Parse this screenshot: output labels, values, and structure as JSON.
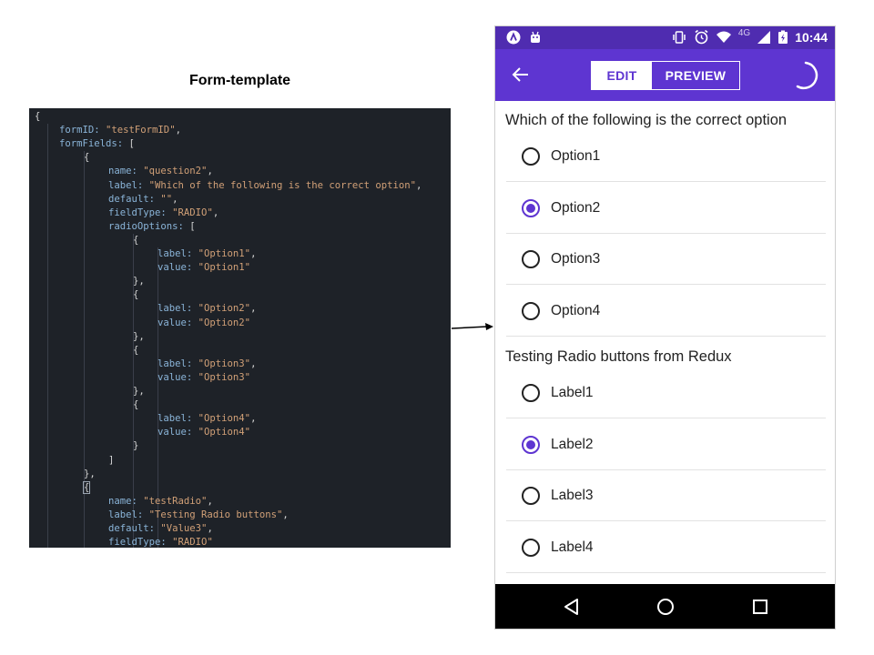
{
  "template": {
    "title": "Form-template",
    "code_lines": [
      {
        "indent": 0,
        "parts": [
          {
            "t": "{",
            "c": "p"
          }
        ]
      },
      {
        "indent": 1,
        "parts": [
          {
            "t": "formID: ",
            "c": "k"
          },
          {
            "t": "\"testFormID\"",
            "c": "s"
          },
          {
            "t": ",",
            "c": "p"
          }
        ]
      },
      {
        "indent": 1,
        "parts": [
          {
            "t": "formFields: ",
            "c": "k"
          },
          {
            "t": "[",
            "c": "p"
          }
        ]
      },
      {
        "indent": 2,
        "parts": [
          {
            "t": "{",
            "c": "p"
          }
        ]
      },
      {
        "indent": 3,
        "parts": [
          {
            "t": "name: ",
            "c": "k"
          },
          {
            "t": "\"question2\"",
            "c": "s"
          },
          {
            "t": ",",
            "c": "p"
          }
        ]
      },
      {
        "indent": 3,
        "parts": [
          {
            "t": "label: ",
            "c": "k"
          },
          {
            "t": "\"Which of the following is the correct option\"",
            "c": "s"
          },
          {
            "t": ",",
            "c": "p"
          }
        ]
      },
      {
        "indent": 3,
        "parts": [
          {
            "t": "default: ",
            "c": "k"
          },
          {
            "t": "\"\"",
            "c": "s"
          },
          {
            "t": ",",
            "c": "p"
          }
        ]
      },
      {
        "indent": 3,
        "parts": [
          {
            "t": "fieldType: ",
            "c": "k"
          },
          {
            "t": "\"RADIO\"",
            "c": "s"
          },
          {
            "t": ",",
            "c": "p"
          }
        ]
      },
      {
        "indent": 3,
        "parts": [
          {
            "t": "radioOptions: ",
            "c": "k"
          },
          {
            "t": "[",
            "c": "p"
          }
        ]
      },
      {
        "indent": 4,
        "parts": [
          {
            "t": "{",
            "c": "p"
          }
        ]
      },
      {
        "indent": 5,
        "parts": [
          {
            "t": "label: ",
            "c": "k"
          },
          {
            "t": "\"Option1\"",
            "c": "s"
          },
          {
            "t": ",",
            "c": "p"
          }
        ]
      },
      {
        "indent": 5,
        "parts": [
          {
            "t": "value: ",
            "c": "k"
          },
          {
            "t": "\"Option1\"",
            "c": "s"
          }
        ]
      },
      {
        "indent": 4,
        "parts": [
          {
            "t": "},",
            "c": "p"
          }
        ]
      },
      {
        "indent": 4,
        "parts": [
          {
            "t": "{",
            "c": "p"
          }
        ]
      },
      {
        "indent": 5,
        "parts": [
          {
            "t": "label: ",
            "c": "k"
          },
          {
            "t": "\"Option2\"",
            "c": "s"
          },
          {
            "t": ",",
            "c": "p"
          }
        ]
      },
      {
        "indent": 5,
        "parts": [
          {
            "t": "value: ",
            "c": "k"
          },
          {
            "t": "\"Option2\"",
            "c": "s"
          }
        ]
      },
      {
        "indent": 4,
        "parts": [
          {
            "t": "},",
            "c": "p"
          }
        ]
      },
      {
        "indent": 4,
        "parts": [
          {
            "t": "{",
            "c": "p"
          }
        ]
      },
      {
        "indent": 5,
        "parts": [
          {
            "t": "label: ",
            "c": "k"
          },
          {
            "t": "\"Option3\"",
            "c": "s"
          },
          {
            "t": ",",
            "c": "p"
          }
        ]
      },
      {
        "indent": 5,
        "parts": [
          {
            "t": "value: ",
            "c": "k"
          },
          {
            "t": "\"Option3\"",
            "c": "s"
          }
        ]
      },
      {
        "indent": 4,
        "parts": [
          {
            "t": "},",
            "c": "p"
          }
        ]
      },
      {
        "indent": 4,
        "parts": [
          {
            "t": "{",
            "c": "p"
          }
        ]
      },
      {
        "indent": 5,
        "parts": [
          {
            "t": "label: ",
            "c": "k"
          },
          {
            "t": "\"Option4\"",
            "c": "s"
          },
          {
            "t": ",",
            "c": "p"
          }
        ]
      },
      {
        "indent": 5,
        "parts": [
          {
            "t": "value: ",
            "c": "k"
          },
          {
            "t": "\"Option4\"",
            "c": "s"
          }
        ]
      },
      {
        "indent": 4,
        "parts": [
          {
            "t": "}",
            "c": "p"
          }
        ]
      },
      {
        "indent": 3,
        "parts": [
          {
            "t": "]",
            "c": "p"
          }
        ]
      },
      {
        "indent": 2,
        "parts": [
          {
            "t": "},",
            "c": "p"
          }
        ]
      },
      {
        "indent": 2,
        "parts": [
          {
            "t": "{",
            "c": "p",
            "hl": true
          }
        ]
      },
      {
        "indent": 3,
        "parts": [
          {
            "t": "name: ",
            "c": "k"
          },
          {
            "t": "\"testRadio\"",
            "c": "s"
          },
          {
            "t": ",",
            "c": "p"
          }
        ]
      },
      {
        "indent": 3,
        "parts": [
          {
            "t": "label: ",
            "c": "k"
          },
          {
            "t": "\"Testing Radio buttons\"",
            "c": "s"
          },
          {
            "t": ",",
            "c": "p"
          }
        ]
      },
      {
        "indent": 3,
        "parts": [
          {
            "t": "default: ",
            "c": "k"
          },
          {
            "t": "\"Value3\"",
            "c": "s"
          },
          {
            "t": ",",
            "c": "p"
          }
        ]
      },
      {
        "indent": 3,
        "parts": [
          {
            "t": "fieldType: ",
            "c": "k"
          },
          {
            "t": "\"RADIO\"",
            "c": "s"
          }
        ]
      }
    ]
  },
  "status_bar": {
    "network": "4G",
    "time": "10:44"
  },
  "app_bar": {
    "tab_edit": "EDIT",
    "tab_preview": "PREVIEW",
    "active_tab": "EDIT"
  },
  "form": {
    "groups": [
      {
        "question": "Which of the following is the correct option",
        "options": [
          {
            "label": "Option1",
            "checked": false
          },
          {
            "label": "Option2",
            "checked": true
          },
          {
            "label": "Option3",
            "checked": false
          },
          {
            "label": "Option4",
            "checked": false
          }
        ]
      },
      {
        "question": "Testing Radio buttons from Redux",
        "options": [
          {
            "label": "Label1",
            "checked": false
          },
          {
            "label": "Label2",
            "checked": true
          },
          {
            "label": "Label3",
            "checked": false
          },
          {
            "label": "Label4",
            "checked": false
          }
        ]
      }
    ]
  },
  "colors": {
    "accent": "#5e35d1",
    "status_bar": "#4f2cb0",
    "code_bg": "#1e2228",
    "code_key": "#8ab4d8",
    "code_string": "#d1a077"
  }
}
